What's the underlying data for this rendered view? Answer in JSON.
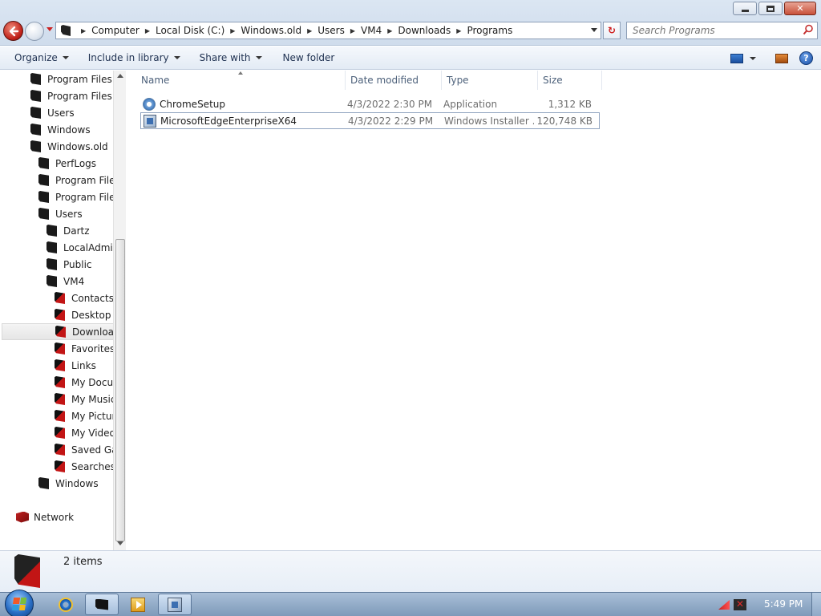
{
  "window": {
    "address_path": [
      "Computer",
      "Local Disk (C:)",
      "Windows.old",
      "Users",
      "VM4",
      "Downloads",
      "Programs"
    ],
    "search_placeholder": "Search Programs"
  },
  "toolbar": {
    "organize": "Organize",
    "include_in_library": "Include in library",
    "share_with": "Share with",
    "new_folder": "New folder"
  },
  "nav_tree": [
    {
      "label": "Program Files",
      "level": 0,
      "icon": "folder-icon"
    },
    {
      "label": "Program Files (",
      "level": 0,
      "icon": "folder-icon"
    },
    {
      "label": "Users",
      "level": 0,
      "icon": "folder-icon"
    },
    {
      "label": "Windows",
      "level": 0,
      "icon": "folder-icon"
    },
    {
      "label": "Windows.old",
      "level": 0,
      "icon": "folder-icon"
    },
    {
      "label": "PerfLogs",
      "level": 1,
      "icon": "folder-icon"
    },
    {
      "label": "Program Files",
      "level": 1,
      "icon": "folder-icon"
    },
    {
      "label": "Program Files",
      "level": 1,
      "icon": "folder-icon"
    },
    {
      "label": "Users",
      "level": 1,
      "icon": "folder-icon"
    },
    {
      "label": "Dartz",
      "level": 2,
      "icon": "folder-icon"
    },
    {
      "label": "LocalAdmin",
      "level": 2,
      "icon": "folder-icon"
    },
    {
      "label": "Public",
      "level": 2,
      "icon": "folder-icon"
    },
    {
      "label": "VM4",
      "level": 2,
      "icon": "folder-icon"
    },
    {
      "label": "Contacts",
      "level": 3,
      "icon": "contacts-folder-icon"
    },
    {
      "label": "Desktop",
      "level": 3,
      "icon": "desktop-folder-icon"
    },
    {
      "label": "Downloads",
      "level": 3,
      "icon": "downloads-folder-icon",
      "selected": true
    },
    {
      "label": "Favorites",
      "level": 3,
      "icon": "favorites-folder-icon"
    },
    {
      "label": "Links",
      "level": 3,
      "icon": "links-folder-icon"
    },
    {
      "label": "My Documents",
      "level": 3,
      "icon": "documents-folder-icon"
    },
    {
      "label": "My Music",
      "level": 3,
      "icon": "music-folder-icon"
    },
    {
      "label": "My Pictures",
      "level": 3,
      "icon": "pictures-folder-icon"
    },
    {
      "label": "My Videos",
      "level": 3,
      "icon": "videos-folder-icon"
    },
    {
      "label": "Saved Games",
      "level": 3,
      "icon": "saved-games-folder-icon"
    },
    {
      "label": "Searches",
      "level": 3,
      "icon": "searches-folder-icon"
    },
    {
      "label": "Windows",
      "level": 1,
      "icon": "folder-icon"
    }
  ],
  "network_label": "Network",
  "columns": {
    "name": "Name",
    "date_modified": "Date modified",
    "type": "Type",
    "size": "Size"
  },
  "files": [
    {
      "name": "ChromeSetup",
      "date_modified": "4/3/2022 2:30 PM",
      "type": "Application",
      "size": "1,312 KB",
      "icon": "application-icon"
    },
    {
      "name": "MicrosoftEdgeEnterpriseX64",
      "date_modified": "4/3/2022 2:29 PM",
      "type": "Windows Installer ...",
      "size": "120,748 KB",
      "icon": "installer-icon",
      "selected": true
    }
  ],
  "status": {
    "item_count": "2 items"
  },
  "taskbar": {
    "clock": "5:49 PM"
  }
}
